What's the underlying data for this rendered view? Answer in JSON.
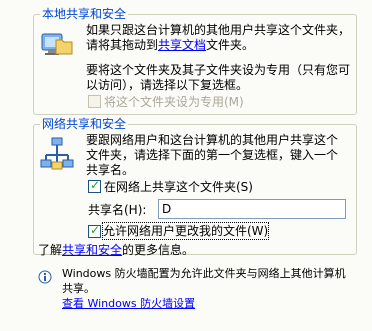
{
  "local_sharing": {
    "title": "本地共享和安全",
    "line1_a": "如果只跟这台计算机的其他用户共享这个文件夹，",
    "line1_b": "请将其拖动到",
    "shared_docs_link": "共享文档",
    "line1_c": "文件夹。",
    "line2_a": "要将这个文件夹及其子文件夹设为专用（只有您可",
    "line2_b": "以访问），请选择以下复选框。",
    "private_checkbox_label": "将这个文件夹设为专用(M)"
  },
  "network_sharing": {
    "title": "网络共享和安全",
    "desc1": "要跟网络用户和这台计算机的其他用户共享这个",
    "desc2": "文件夹，请选择下面的第一个复选框，键入一个",
    "desc3": "共享名。",
    "share_checkbox_label": "在网络上共享这个文件夹(S)",
    "share_name_label": "共享名(H):",
    "share_name_value": "D",
    "allow_change_label": "允许网络用户更改我的文件(W)",
    "learn_more_a": "了解",
    "learn_more_link": "共享和安全",
    "learn_more_b": "的更多信息。"
  },
  "firewall": {
    "line1": "Windows 防火墙配置为允许此文件夹与网络上其他计算机",
    "line2": "共享。",
    "link": "查看 Windows 防火墙设置"
  }
}
